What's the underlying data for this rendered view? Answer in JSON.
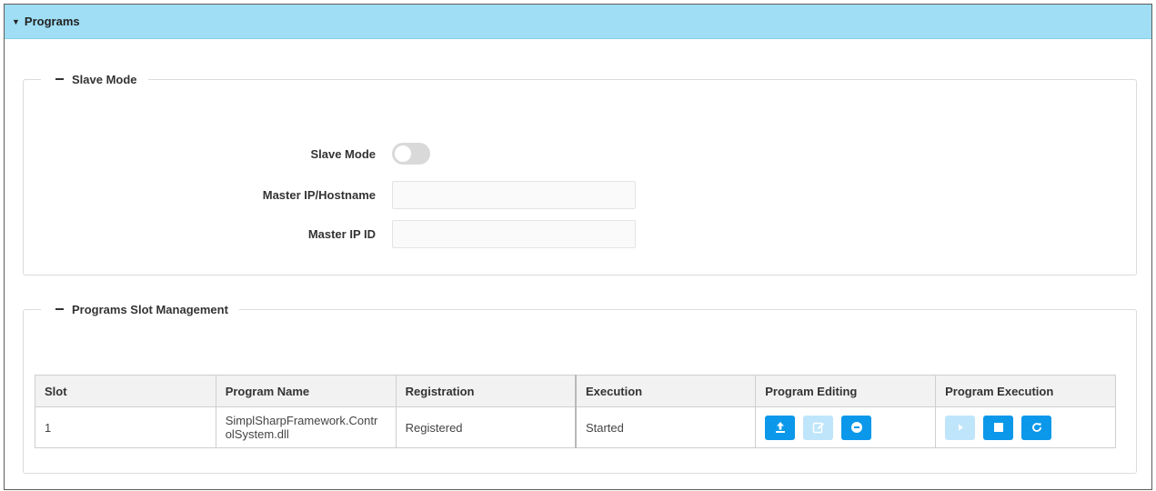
{
  "panel": {
    "title": "Programs"
  },
  "slave_mode_section": {
    "title": "Slave Mode",
    "fields": {
      "slave_mode": {
        "label": "Slave Mode",
        "enabled": false
      },
      "master_ip_hostname": {
        "label": "Master IP/Hostname",
        "value": ""
      },
      "master_ip_id": {
        "label": "Master IP ID",
        "value": ""
      }
    }
  },
  "slot_section": {
    "title": "Programs Slot Management",
    "columns": [
      "Slot",
      "Program Name",
      "Registration",
      "Execution",
      "Program Editing",
      "Program Execution"
    ],
    "rows": [
      {
        "slot": "1",
        "program_name": "SimplSharpFramework.ControlSystem.dll",
        "program_name_line1": "SimplSharpFramework.Contr",
        "program_name_line2": "olSystem.dll",
        "registration": "Registered",
        "execution": "Started"
      }
    ],
    "editing_buttons": [
      {
        "icon": "upload-icon",
        "enabled": true
      },
      {
        "icon": "edit-icon",
        "enabled": false
      },
      {
        "icon": "remove-icon",
        "enabled": true
      }
    ],
    "execution_buttons": [
      {
        "icon": "play-icon",
        "enabled": false
      },
      {
        "icon": "stop-icon",
        "enabled": true
      },
      {
        "icon": "restart-icon",
        "enabled": true
      }
    ]
  },
  "colors": {
    "header_bg": "#9fdef4",
    "button_primary": "#0b98ea",
    "button_disabled": "#bfe5fb",
    "status_green": "#5ea33b"
  }
}
